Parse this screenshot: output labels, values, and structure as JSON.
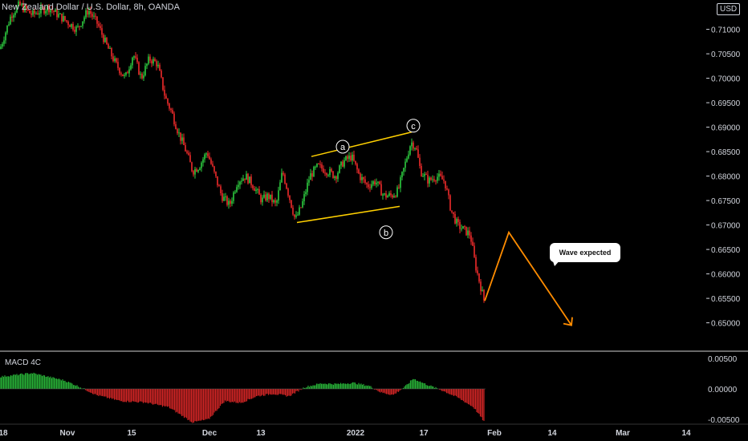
{
  "header": {
    "title": "New Zealand Dollar / U.S. Dollar, 8h, OANDA",
    "currency_badge": "USD"
  },
  "indicator": {
    "label": "MACD 4C"
  },
  "annotations": {
    "callout": "Wave expected",
    "waves": [
      "a",
      "b",
      "c"
    ]
  },
  "colors": {
    "up": "#26a69a",
    "up_bright": "#2ecc40",
    "down": "#ef2b2b",
    "channel": "#ffd000",
    "projection": "#ff8c00",
    "axis_text": "#d1d4dc",
    "divider": "#cfcfcf"
  },
  "chart_data": [
    {
      "type": "candlestick",
      "title": "New Zealand Dollar / U.S. Dollar, 8h, OANDA",
      "y_ticks": [
        "0.71000",
        "0.70500",
        "0.70000",
        "0.69500",
        "0.69000",
        "0.68500",
        "0.68000",
        "0.67500",
        "0.67000",
        "0.66500",
        "0.66000",
        "0.65500",
        "0.65000"
      ],
      "ylim": [
        0.646,
        0.716
      ],
      "x_ticks": [
        "18",
        "Nov",
        "15",
        "Dec",
        "13",
        "2022",
        "17",
        "Feb",
        "14",
        "Mar",
        "14"
      ],
      "grid": false,
      "price_path": [
        [
          0,
          0.706
        ],
        [
          6,
          0.709
        ],
        [
          14,
          0.713
        ],
        [
          24,
          0.715
        ],
        [
          40,
          0.713
        ],
        [
          60,
          0.7145
        ],
        [
          80,
          0.712
        ],
        [
          96,
          0.71
        ],
        [
          110,
          0.714
        ],
        [
          122,
          0.711
        ],
        [
          132,
          0.707
        ],
        [
          144,
          0.703
        ],
        [
          156,
          0.7
        ],
        [
          166,
          0.705
        ],
        [
          176,
          0.7
        ],
        [
          186,
          0.704
        ],
        [
          196,
          0.703
        ],
        [
          206,
          0.696
        ],
        [
          214,
          0.693
        ],
        [
          222,
          0.689
        ],
        [
          232,
          0.685
        ],
        [
          240,
          0.681
        ],
        [
          248,
          0.682
        ],
        [
          258,
          0.685
        ],
        [
          266,
          0.681
        ],
        [
          276,
          0.676
        ],
        [
          286,
          0.674
        ],
        [
          296,
          0.679
        ],
        [
          306,
          0.68
        ],
        [
          316,
          0.678
        ],
        [
          326,
          0.675
        ],
        [
          334,
          0.676
        ],
        [
          344,
          0.674
        ],
        [
          352,
          0.681
        ],
        [
          360,
          0.676
        ],
        [
          368,
          0.671
        ],
        [
          376,
          0.674
        ],
        [
          386,
          0.68
        ],
        [
          396,
          0.682
        ],
        [
          408,
          0.681
        ],
        [
          418,
          0.68
        ],
        [
          428,
          0.683
        ],
        [
          438,
          0.684
        ],
        [
          448,
          0.68
        ],
        [
          458,
          0.678
        ],
        [
          468,
          0.679
        ],
        [
          478,
          0.676
        ],
        [
          488,
          0.676
        ],
        [
          496,
          0.677
        ],
        [
          504,
          0.682
        ],
        [
          512,
          0.687
        ],
        [
          518,
          0.686
        ],
        [
          524,
          0.681
        ],
        [
          534,
          0.679
        ],
        [
          544,
          0.68
        ],
        [
          554,
          0.679
        ],
        [
          562,
          0.673
        ],
        [
          570,
          0.67
        ],
        [
          578,
          0.669
        ],
        [
          586,
          0.668
        ],
        [
          592,
          0.662
        ],
        [
          598,
          0.658
        ],
        [
          604,
          0.654
        ]
      ],
      "channel": {
        "upper": [
          [
            388,
            0.684
          ],
          [
            513,
            0.689
          ]
        ],
        "lower": [
          [
            370,
            0.6705
          ],
          [
            498,
            0.6738
          ]
        ]
      },
      "waves": [
        {
          "label": "a",
          "x": 427,
          "price": 0.686
        },
        {
          "label": "b",
          "x": 481,
          "price": 0.6685
        },
        {
          "label": "c",
          "x": 515,
          "price": 0.6903
        }
      ],
      "projection": [
        [
          604,
          0.6545
        ],
        [
          634,
          0.6685
        ],
        [
          712,
          0.6495
        ]
      ]
    },
    {
      "type": "histogram",
      "title": "MACD 4C",
      "y_ticks": [
        "0.00500",
        "0.00000",
        "-0.00500"
      ],
      "ylim": [
        -0.0058,
        0.0058
      ],
      "macd_path": [
        [
          0,
          0.002
        ],
        [
          40,
          0.0026
        ],
        [
          80,
          0.0014
        ],
        [
          100,
          0.0003
        ],
        [
          120,
          -0.001
        ],
        [
          150,
          -0.002
        ],
        [
          180,
          -0.0022
        ],
        [
          210,
          -0.003
        ],
        [
          240,
          -0.0055
        ],
        [
          260,
          -0.005
        ],
        [
          280,
          -0.002
        ],
        [
          300,
          -0.0023
        ],
        [
          320,
          -0.0012
        ],
        [
          340,
          -0.0008
        ],
        [
          360,
          -0.0012
        ],
        [
          380,
          0.0003
        ],
        [
          400,
          0.0009
        ],
        [
          420,
          0.0008
        ],
        [
          440,
          0.001
        ],
        [
          460,
          0.0005
        ],
        [
          475,
          -0.0006
        ],
        [
          490,
          -0.001
        ],
        [
          505,
          0.0004
        ],
        [
          515,
          0.0017
        ],
        [
          530,
          0.0008
        ],
        [
          550,
          -0.0002
        ],
        [
          570,
          -0.0014
        ],
        [
          590,
          -0.003
        ],
        [
          604,
          -0.0055
        ]
      ]
    }
  ]
}
